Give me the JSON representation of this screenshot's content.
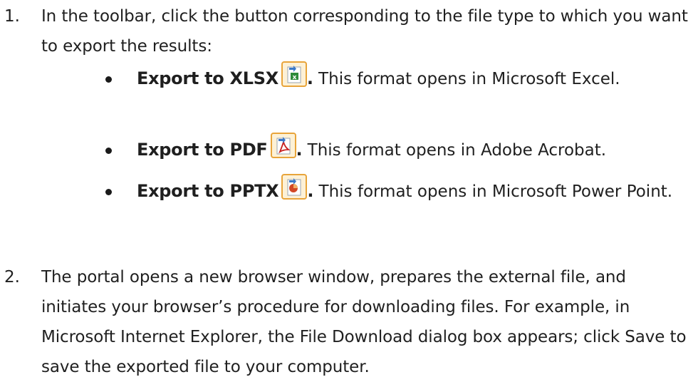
{
  "steps": [
    {
      "number": "1.",
      "text": "In the toolbar, click the button corresponding to the file type to which you want to export the results:"
    },
    {
      "number": "2.",
      "text": "The portal opens a new browser window, prepares the external file, and initiates your browser’s procedure for downloading files. For example, in Microsoft Internet Explorer, the File Download dialog box appears; click Save to save the exported file to your computer."
    }
  ],
  "bullets": [
    {
      "label": "Export to XLSX",
      "icon": "export-xlsx-icon",
      "period": ".",
      "desc": " This format opens in Microsoft Excel."
    },
    {
      "label": "Export to PDF",
      "icon": "export-pdf-icon",
      "period": ".",
      "desc": " This format opens in Adobe Acrobat."
    },
    {
      "label": "Export to PPTX",
      "icon": "export-pptx-icon",
      "period": ".",
      "desc": " This format opens in Microsoft Power Point."
    }
  ],
  "colors": {
    "icon_frame": "#e8a43a",
    "icon_bg": "#fdf1d6",
    "excel_green": "#2e8b3a",
    "pdf_red": "#c8201f",
    "ppt_orange": "#d24726",
    "arrow_blue": "#3a78c8"
  }
}
